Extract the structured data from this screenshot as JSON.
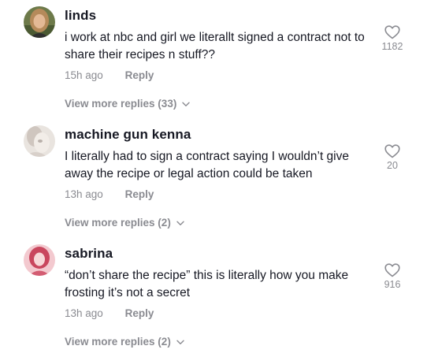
{
  "comments": [
    {
      "username": "linds",
      "text": "i work at nbc and girl we literallt signed a contract not to share their recipes n stuff??",
      "time": "15h ago",
      "reply_label": "Reply",
      "likes": "1182",
      "view_more": "View more replies (33)"
    },
    {
      "username": "machine gun kenna",
      "text": "I literally had to sign a contract saying I wouldn’t give away the recipe or legal action could be taken",
      "time": "13h ago",
      "reply_label": "Reply",
      "likes": "20",
      "view_more": "View more replies (2)"
    },
    {
      "username": "sabrina",
      "text": "“don’t share the recipe” this is literally how you make frosting it’s not a secret",
      "time": "13h ago",
      "reply_label": "Reply",
      "likes": "916",
      "view_more": "View more replies (2)"
    }
  ],
  "icons": {
    "like": "heart-outline-icon",
    "expand": "chevron-down-icon"
  },
  "colors": {
    "text_primary": "#161823",
    "text_secondary": "#8a8b91"
  }
}
